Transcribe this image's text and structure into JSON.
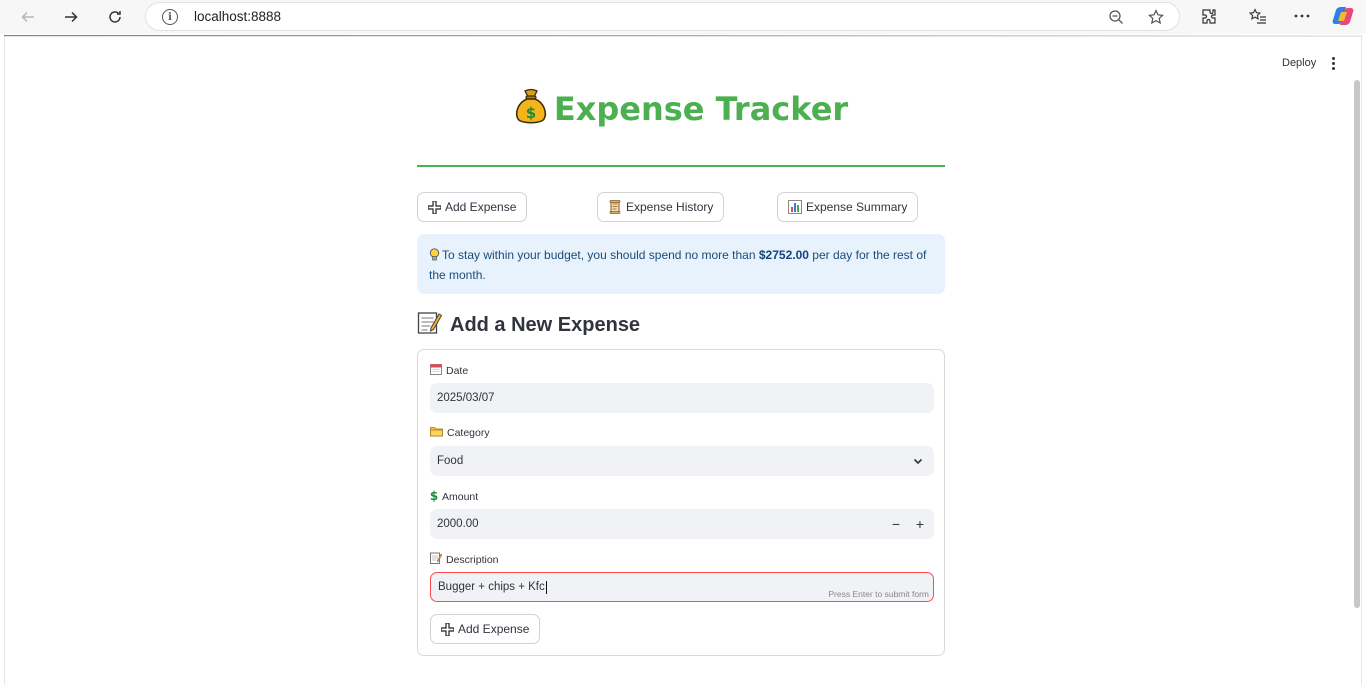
{
  "browser": {
    "url": "localhost:8888"
  },
  "app": {
    "deploy_label": "Deploy",
    "title": "Expense Tracker",
    "nav": {
      "add_label": "Add Expense",
      "history_label": "Expense History",
      "summary_label": "Expense Summary"
    },
    "info": {
      "prefix": "To stay within your budget, you should spend no more than",
      "amount": "$2752.00",
      "suffix": "per day for the rest of the month."
    },
    "section_title": "Add a New Expense",
    "form": {
      "date_label": "Date",
      "date_value": "2025/03/07",
      "category_label": "Category",
      "category_value": "Food",
      "amount_label": "Amount",
      "amount_value": "2000.00",
      "minus": "−",
      "plus": "+",
      "description_label": "Description",
      "description_value": "Bugger + chips + Kfc",
      "hint": "Press Enter to submit form",
      "submit_label": "Add Expense"
    }
  },
  "colors": {
    "accent_green": "#4caf50",
    "info_bg": "#e7f2fc",
    "focus_red": "#ff4b4b"
  }
}
